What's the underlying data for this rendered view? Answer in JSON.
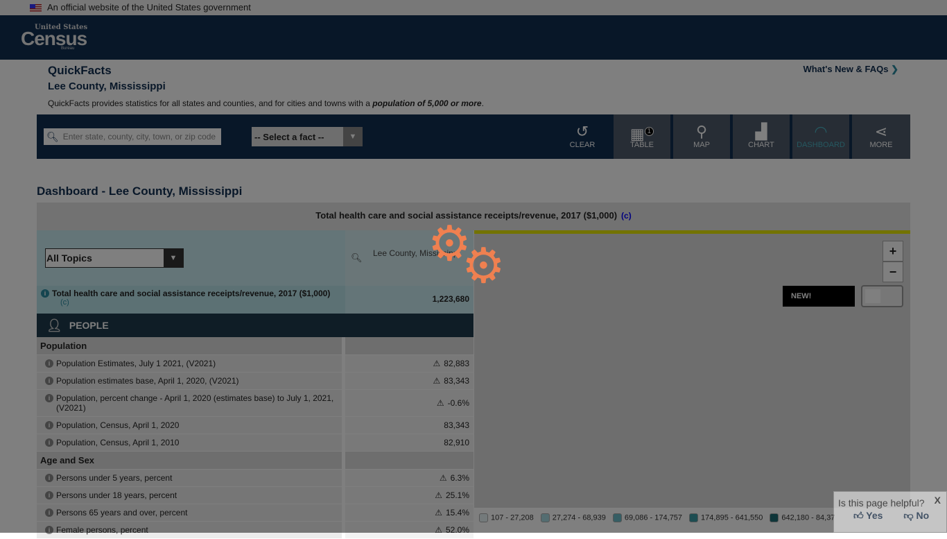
{
  "gov_banner": "An official website of the United States government",
  "logo": {
    "top": "United States",
    "main": "Census",
    "bottom": "Bureau"
  },
  "header": {
    "title": "QuickFacts",
    "subtitle": "Lee County, Mississippi",
    "desc_pre": "QuickFacts provides statistics for all states and counties, and for cities and towns with a ",
    "desc_em": "population of 5,000 or more",
    "desc_post": ".",
    "faq": "What's New & FAQs"
  },
  "toolbar": {
    "search_placeholder": "Enter state, county, city, town, or zip code",
    "select_fact": "-- Select a fact --",
    "buttons": [
      {
        "label": "CLEAR",
        "icon": "undo-icon"
      },
      {
        "label": "TABLE",
        "icon": "table-icon",
        "badge": "1"
      },
      {
        "label": "MAP",
        "icon": "map-pin-icon"
      },
      {
        "label": "CHART",
        "icon": "bar-chart-icon"
      },
      {
        "label": "DASHBOARD",
        "icon": "gauge-icon",
        "active": true
      },
      {
        "label": "MORE",
        "icon": "share-icon"
      }
    ]
  },
  "dashboard": {
    "title": "Dashboard - Lee County, Mississippi",
    "fact_title": "Total health care and social assistance receipts/revenue, 2017 ($1,000)",
    "fact_note": "(c)"
  },
  "table": {
    "topics": "All Topics",
    "column": "Lee County, Mississippi",
    "highlight": {
      "label": "Total health care and social assistance receipts/revenue, 2017 ($1,000)",
      "note": "(c)",
      "value": "1,223,680"
    },
    "section": "PEOPLE",
    "rows": [
      {
        "cat": "Population"
      },
      {
        "label": "Population Estimates, July 1 2021, (V2021)",
        "value": "82,883",
        "warn": true
      },
      {
        "label": "Population estimates base, April 1, 2020, (V2021)",
        "value": "83,343",
        "warn": true
      },
      {
        "label": "Population, percent change - April 1, 2020 (estimates base) to July 1, 2021, (V2021)",
        "value": "-0.6%",
        "warn": true
      },
      {
        "label": "Population, Census, April 1, 2020",
        "value": "83,343"
      },
      {
        "label": "Population, Census, April 1, 2010",
        "value": "82,910"
      },
      {
        "cat": "Age and Sex"
      },
      {
        "label": "Persons under 5 years, percent",
        "value": "6.3%",
        "warn": true
      },
      {
        "label": "Persons under 18 years, percent",
        "value": "25.1%",
        "warn": true
      },
      {
        "label": "Persons 65 years and over, percent",
        "value": "15.4%",
        "warn": true
      },
      {
        "label": "Female persons, percent",
        "value": "52.0%",
        "warn": true
      }
    ]
  },
  "map": {
    "zoom_in": "+",
    "zoom_out": "−",
    "new_label": "NEW!",
    "legend": [
      {
        "label": "107 - 27,208",
        "color": "#e8f4f6"
      },
      {
        "label": "27,274 - 68,939",
        "color": "#a8dbe3"
      },
      {
        "label": "69,086 - 174,757",
        "color": "#6cbcc8"
      },
      {
        "label": "174,895 - 641,550",
        "color": "#3b9aa4"
      },
      {
        "label": "642,180 - 84,37",
        "color": "#1f6c74"
      }
    ]
  },
  "feedback": {
    "question": "Is this page helpful?",
    "yes": "Yes",
    "no": "No",
    "close": "X"
  }
}
